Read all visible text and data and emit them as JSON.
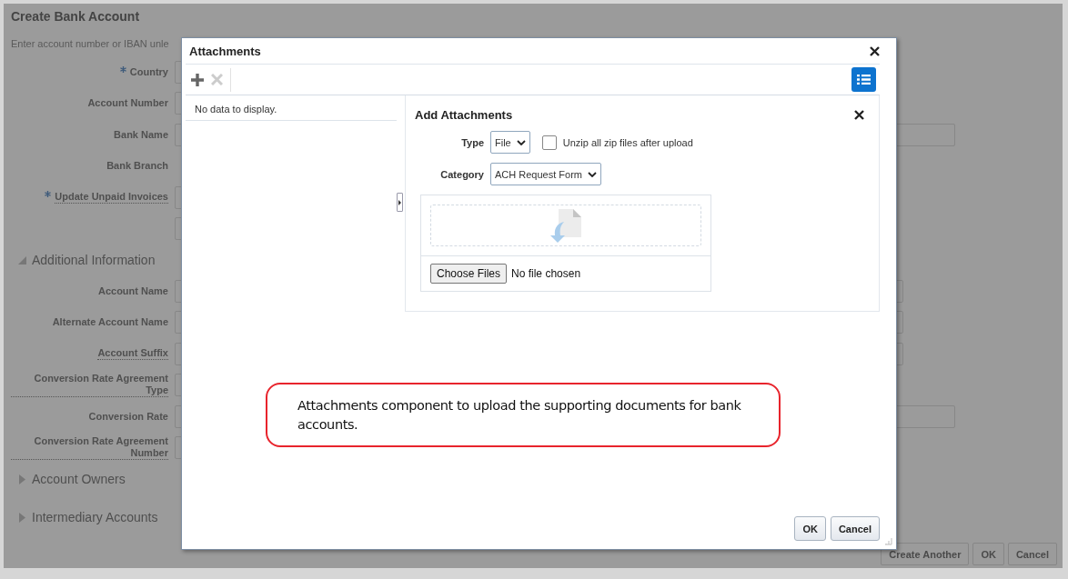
{
  "page": {
    "title": "Create Bank Account",
    "instruction": "Enter account number or IBAN unle",
    "fields": [
      {
        "label": "Country",
        "required": true,
        "help": false,
        "kind": "hidden"
      },
      {
        "label": "Account Number",
        "required": false,
        "help": false,
        "kind": "hidden"
      },
      {
        "label": "Bank Name",
        "required": false,
        "help": false,
        "kind": "long"
      },
      {
        "label": "Bank Branch",
        "required": false,
        "help": false,
        "kind": "none"
      },
      {
        "label": "Update Unpaid Invoices",
        "required": true,
        "help": true,
        "kind": "hidden"
      },
      {
        "kind": "hidden"
      }
    ],
    "sections": [
      {
        "label": "Additional Information",
        "expanded": true,
        "fields": [
          {
            "label": "Account Name",
            "required": false,
            "help": false,
            "kind": "medium"
          },
          {
            "label": "Alternate Account Name",
            "required": false,
            "help": false,
            "kind": "medium"
          },
          {
            "label": "Account Suffix",
            "required": false,
            "help": true,
            "kind": "medium"
          },
          {
            "label": "Conversion Rate Agreement Type",
            "required": false,
            "help": true,
            "kind": "hidden"
          },
          {
            "label": "Conversion Rate",
            "required": false,
            "help": false,
            "kind": "long"
          },
          {
            "label": "Conversion Rate Agreement Number",
            "required": false,
            "help": true,
            "kind": "hidden"
          }
        ]
      },
      {
        "label": "Account Owners",
        "expanded": false
      },
      {
        "label": "Intermediary Accounts",
        "expanded": false
      }
    ],
    "buttons": [
      "Create Another",
      "OK",
      "Cancel"
    ]
  },
  "dialog": {
    "title": "Attachments",
    "empty_message": "No data to display.",
    "add": {
      "title": "Add Attachments",
      "type_label": "Type",
      "type_value": "File",
      "unzip_label": "Unzip all zip files after upload",
      "unzip_checked": false,
      "category_label": "Category",
      "category_value": "ACH Request Form",
      "choose_button": "Choose Files",
      "file_status": "No file chosen"
    },
    "callout": "Attachments component to upload the supporting documents for bank accounts.",
    "buttons": [
      "OK",
      "Cancel"
    ]
  }
}
